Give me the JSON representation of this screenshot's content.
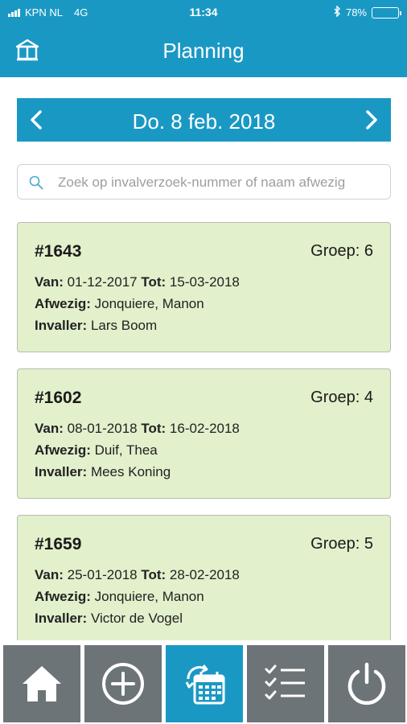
{
  "status_bar": {
    "carrier": "KPN NL",
    "network": "4G",
    "time": "11:34",
    "bluetooth_icon": "bluetooth-icon",
    "battery_percent_label": "78%",
    "battery_level": 0.78
  },
  "header": {
    "title": "Planning",
    "left_icon": "book-icon"
  },
  "date_nav": {
    "label": "Do. 8 feb. 2018",
    "prev_icon": "chevron-left-icon",
    "next_icon": "chevron-right-icon"
  },
  "search": {
    "placeholder": "Zoek op invalverzoek-nummer of naam afwezig",
    "value": ""
  },
  "labels": {
    "van": "Van:",
    "tot": "Tot:",
    "afwezig": "Afwezig:",
    "invaller": "Invaller:"
  },
  "requests": [
    {
      "number": "#1643",
      "group": "Groep: 6",
      "van": "01-12-2017",
      "tot": "15-03-2018",
      "afwezig": "Jonquiere, Manon",
      "invaller": "Lars Boom"
    },
    {
      "number": "#1602",
      "group": "Groep: 4",
      "van": "08-01-2018",
      "tot": "16-02-2018",
      "afwezig": "Duif, Thea",
      "invaller": "Mees Koning"
    },
    {
      "number": "#1659",
      "group": "Groep: 5",
      "van": "25-01-2018",
      "tot": "28-02-2018",
      "afwezig": "Jonquiere, Manon",
      "invaller": "Victor de Vogel"
    }
  ],
  "tabs": [
    {
      "icon": "home-icon",
      "active": false
    },
    {
      "icon": "plus-circle-icon",
      "active": false
    },
    {
      "icon": "calendar-sync-icon",
      "active": true
    },
    {
      "icon": "checklist-icon",
      "active": false
    },
    {
      "icon": "power-icon",
      "active": false
    }
  ],
  "colors": {
    "primary": "#1a98c4",
    "card_background": "#e2f0cc",
    "tab_inactive": "#6d7478",
    "tab_active": "#1a98c4"
  }
}
